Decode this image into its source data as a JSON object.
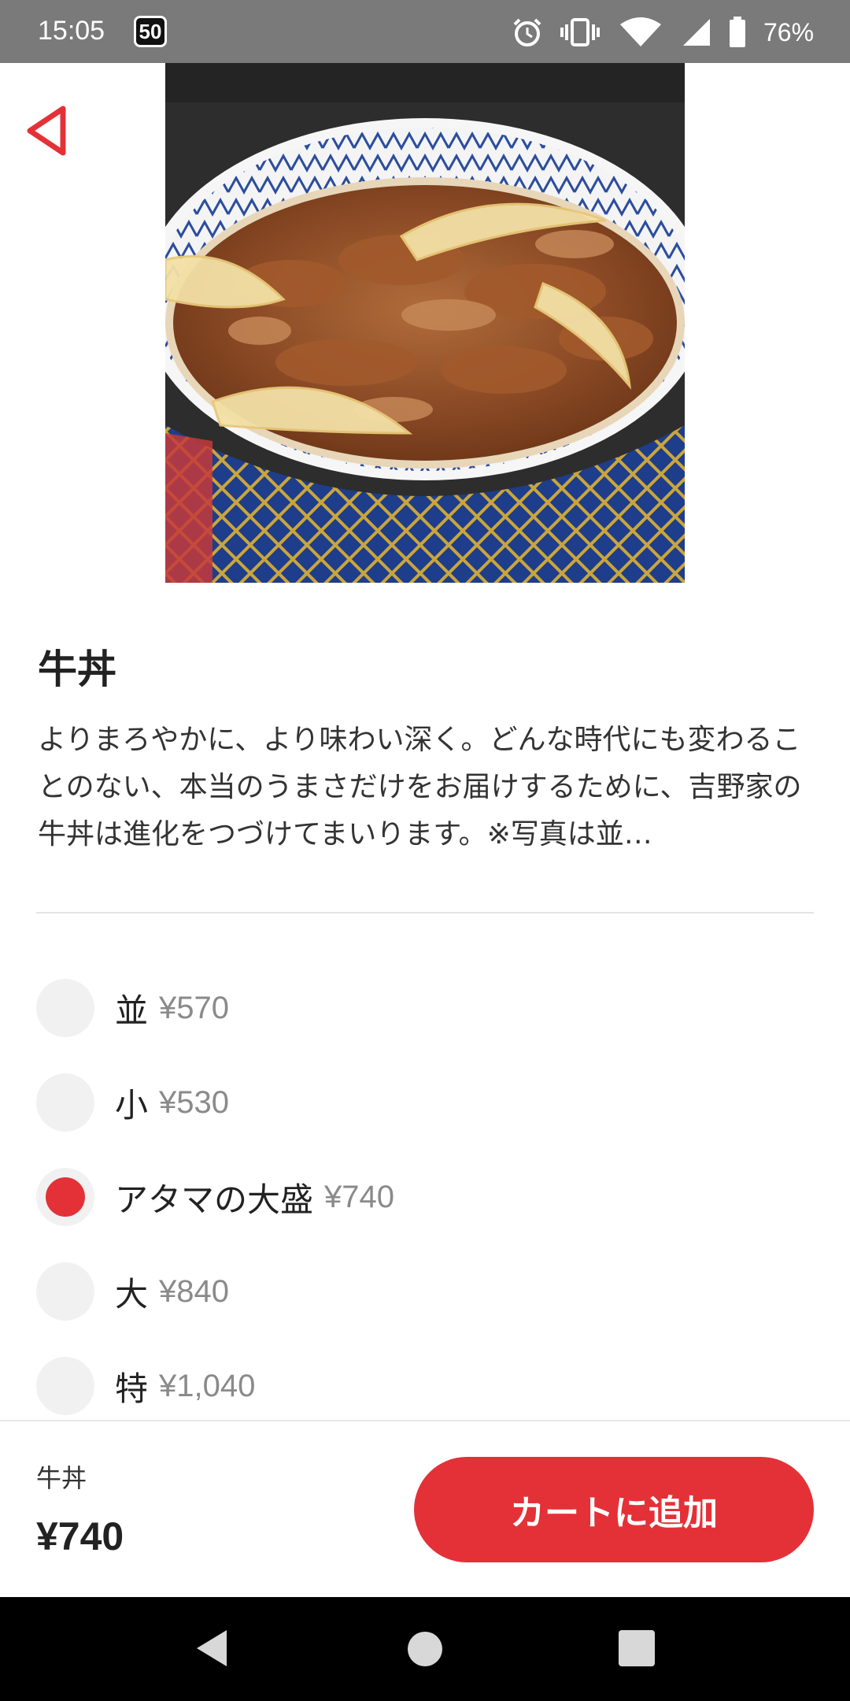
{
  "status_bar": {
    "time": "15:05",
    "badge": "50",
    "battery": "76%"
  },
  "product": {
    "title": "牛丼",
    "description": "よりまろやかに、より味わい深く。どんな時代にも変わることのない、本当のうまさだけをお届けするために、吉野家の牛丼は進化をつづけてまいります。※写真は並…"
  },
  "options": [
    {
      "label": "並",
      "price": "¥570",
      "selected": false
    },
    {
      "label": "小",
      "price": "¥530",
      "selected": false
    },
    {
      "label": "アタマの大盛",
      "price": "¥740",
      "selected": true
    },
    {
      "label": "大",
      "price": "¥840",
      "selected": false
    },
    {
      "label": "特",
      "price": "¥1,040",
      "selected": false
    }
  ],
  "summary": {
    "name": "牛丼",
    "price": "¥740"
  },
  "cart_button": "カートに追加",
  "colors": {
    "accent": "#e43137",
    "status_bar": "#7a7a7a",
    "nav_bar": "#000000"
  },
  "icons": {
    "back": "back-triangle-icon",
    "alarm": "alarm-icon",
    "vibrate": "vibrate-icon",
    "wifi": "wifi-icon",
    "signal": "signal-icon",
    "battery": "battery-icon"
  }
}
